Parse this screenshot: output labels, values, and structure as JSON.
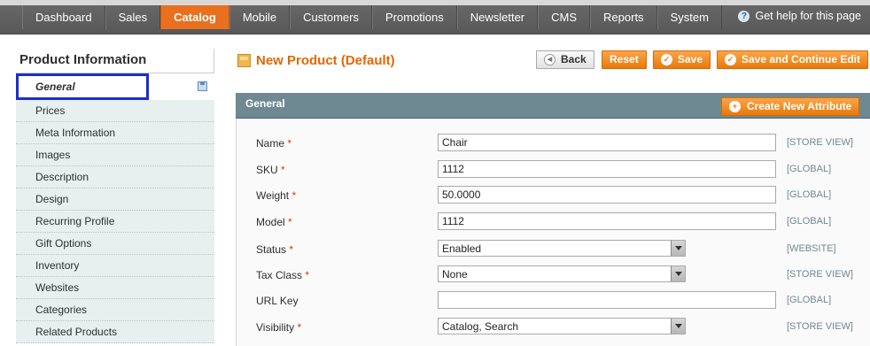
{
  "nav": {
    "tabs": [
      "Dashboard",
      "Sales",
      "Catalog",
      "Mobile",
      "Customers",
      "Promotions",
      "Newsletter",
      "CMS",
      "Reports",
      "System"
    ],
    "active": "Catalog",
    "help": "Get help for this page"
  },
  "sidebar": {
    "title": "Product Information",
    "items": [
      "General",
      "Prices",
      "Meta Information",
      "Images",
      "Description",
      "Design",
      "Recurring Profile",
      "Gift Options",
      "Inventory",
      "Websites",
      "Categories",
      "Related Products"
    ]
  },
  "header": {
    "title": "New Product (Default)",
    "back": "Back",
    "reset": "Reset",
    "save": "Save",
    "save_continue": "Save and Continue Edit"
  },
  "panel": {
    "title": "General",
    "create_attr": "Create New Attribute"
  },
  "form": [
    {
      "label": "Name",
      "required": true,
      "type": "text",
      "value": "Chair",
      "scope": "[STORE VIEW]"
    },
    {
      "label": "SKU",
      "required": true,
      "type": "text",
      "value": "1112",
      "scope": "[GLOBAL]"
    },
    {
      "label": "Weight",
      "required": true,
      "type": "text",
      "value": "50.0000",
      "scope": "[GLOBAL]"
    },
    {
      "label": "Model",
      "required": true,
      "type": "text",
      "value": "1112",
      "scope": "[GLOBAL]"
    },
    {
      "label": "Status",
      "required": true,
      "type": "select",
      "value": "Enabled",
      "scope": "[WEBSITE]"
    },
    {
      "label": "Tax Class",
      "required": true,
      "type": "select",
      "value": "None",
      "scope": "[STORE VIEW]"
    },
    {
      "label": "URL Key",
      "required": false,
      "type": "text",
      "value": "",
      "scope": "[GLOBAL]"
    },
    {
      "label": "Visibility",
      "required": true,
      "type": "select",
      "value": "Catalog, Search",
      "scope": "[STORE VIEW]"
    }
  ],
  "colors": {
    "accent": "#e8701f",
    "panel": "#6f8992",
    "highlight": "#1a2ecc"
  }
}
